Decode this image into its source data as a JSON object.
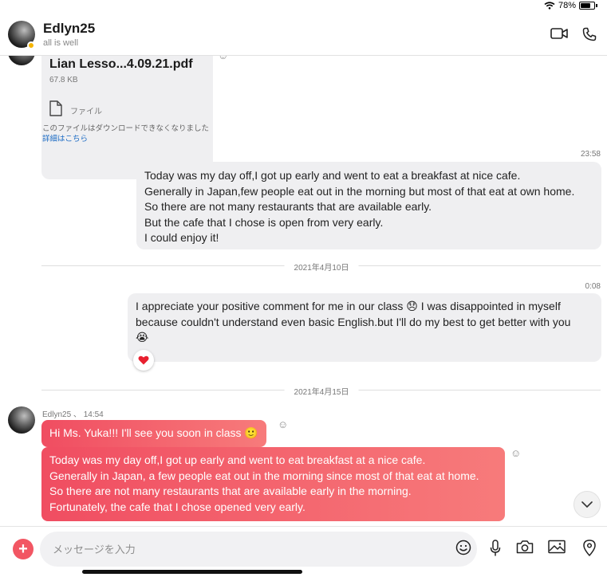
{
  "status_bar": {
    "battery_text": "78%",
    "battery_level": 0.78
  },
  "header": {
    "contact_name": "Edlyn25",
    "contact_status": "all is well"
  },
  "file_message": {
    "file_name": "Lian Lesso...4.09.21.pdf",
    "file_size": "67.8 KB",
    "file_type": "ファイル",
    "note": "このファイルはダウンロードできなくなりました",
    "note_link": "詳細はこちら"
  },
  "messages": [
    {
      "time": "23:58",
      "lines": [
        "Today was my day off,I got up early and went to eat a breakfast at nice cafe.",
        "Generally in Japan,few people eat out in the morning but most of that eat at own home.",
        "So there are not many restaurants that are available early.",
        "But the cafe that I chose is open from very early.",
        "I could enjoy it!"
      ]
    },
    {
      "date_divider": "2021年4月10日",
      "time": "0:08",
      "lines": [
        "I appreciate your positive comment for me in our class 😞 I was disappointed in myself",
        "because couldn't understand even basic English.but I'll do my best to get better with you",
        "😭"
      ],
      "reaction": "heart"
    }
  ],
  "second_divider": "2021年4月15日",
  "contact_messages": {
    "sender_line": "Edlyn25 、 14:54",
    "first": "Hi Ms. Yuka!!! I'll see you soon in class 🙂",
    "second_lines": [
      "Today was my day off,I got up early and went to eat breakfast at a nice cafe.",
      "Generally in Japan, a few people eat out in the morning since most of that eat at home.",
      "So there are not many restaurants that are available early in the morning.",
      "Fortunately, the cafe that I chose opened very early."
    ]
  },
  "composer": {
    "placeholder": "メッセージを入力"
  },
  "colors": {
    "accent": "#f25663",
    "bubble_gradient_start": "#f04d61",
    "bubble_gradient_end": "#f77b7b",
    "incoming_bubble": "#efeff1",
    "link": "#1a6ac4"
  }
}
